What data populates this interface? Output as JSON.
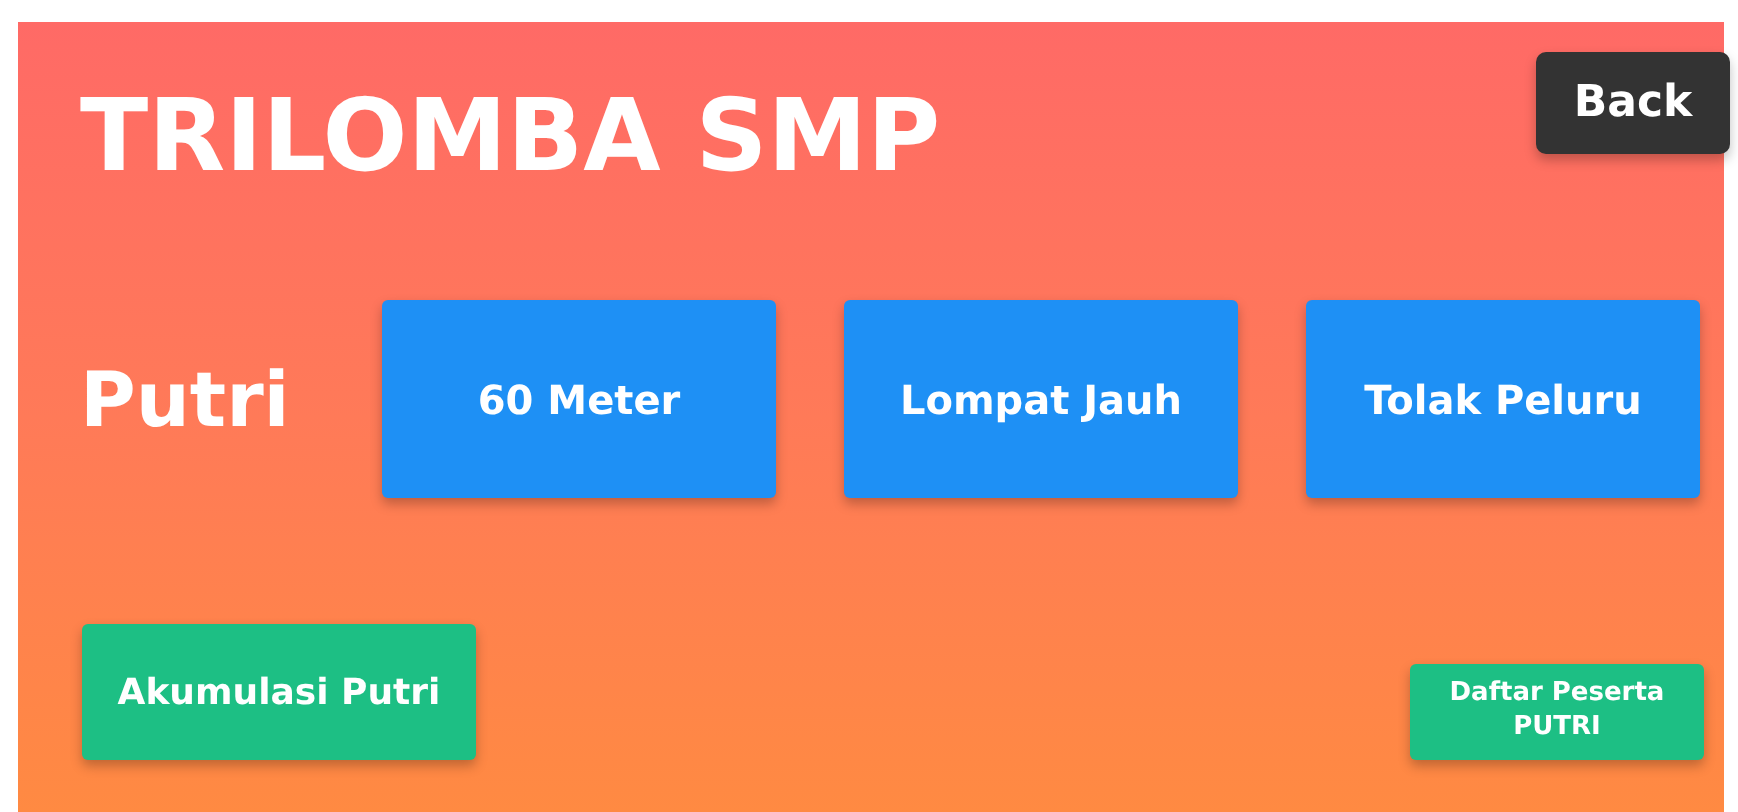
{
  "title": "TRILOMBA SMP",
  "back_button": "Back",
  "category": "Putri",
  "events": [
    "60 Meter",
    "Lompat Jauh",
    "Tolak Peluru"
  ],
  "accumulation_button": "Akumulasi Putri",
  "participants_button": "Daftar Peserta PUTRI"
}
